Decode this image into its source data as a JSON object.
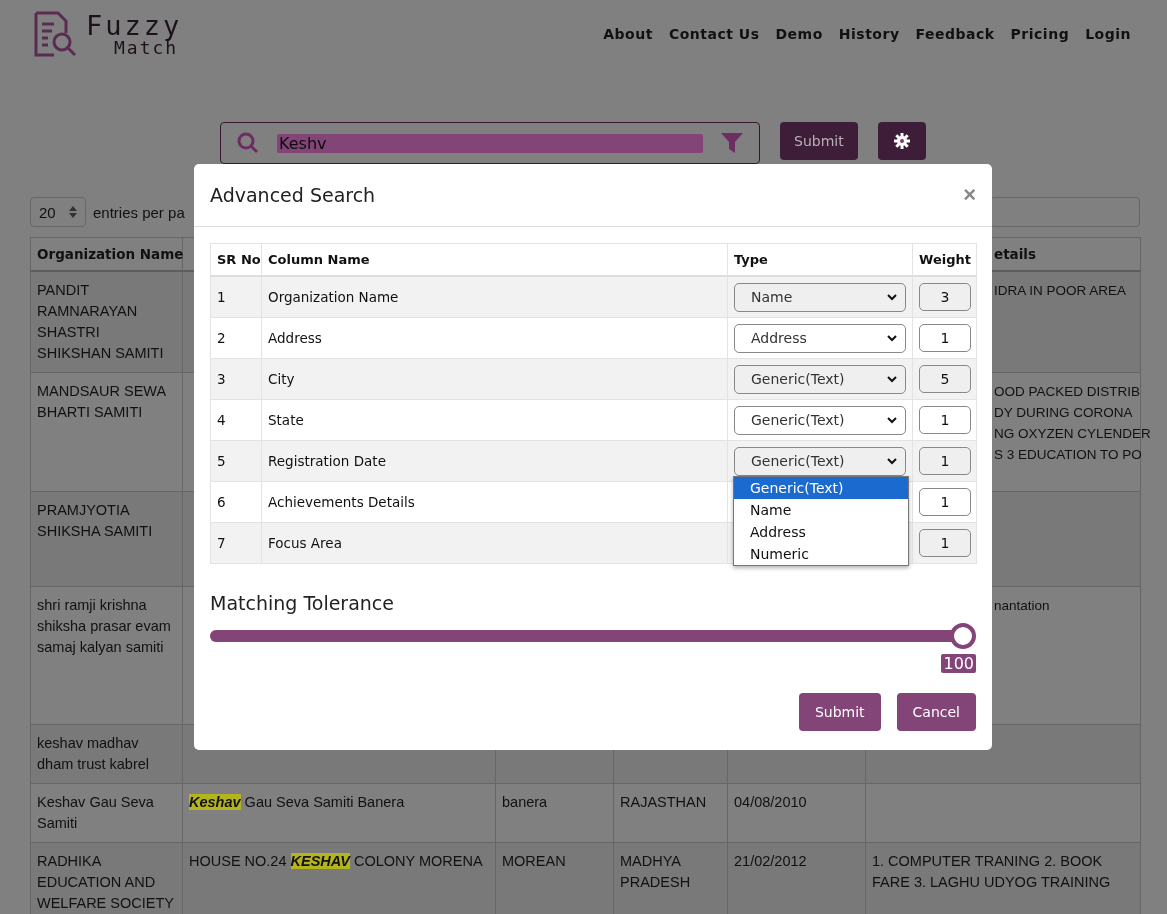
{
  "brand": {
    "line1": "Fuzzy",
    "line2": "Match"
  },
  "nav": [
    "About",
    "Contact Us",
    "Demo",
    "History",
    "Feedback",
    "Pricing",
    "Login"
  ],
  "search": {
    "value": "Keshv",
    "submit": "Submit"
  },
  "entries": {
    "value": "20",
    "label": "entries per pa"
  },
  "table": {
    "header": {
      "organization": "Organization Name",
      "details": [
        "etails"
      ]
    },
    "rows": [
      {
        "organization": "PANDIT RAMNARAYAN SHASTRI SHIKSHAN SAMITI",
        "details": [
          "IDRA IN POOR AREA"
        ]
      },
      {
        "organization": "MANDSAUR SEWA BHARTI SAMITI",
        "details": [
          "OOD PACKED DISTRIB",
          "DY DURING CORONA",
          "NG OXYZEN CYLENDER",
          "S 3 EDUCATION TO PO"
        ]
      },
      {
        "organization": "PRAMJYOTIA SHIKSHA SAMITI"
      },
      {
        "organization": "shri ramji krishna shiksha prasar evam samaj kalyan samiti",
        "details": [
          "nantation"
        ]
      },
      {
        "organization": "keshav madhav dham trust kabrel"
      },
      {
        "organization": "Keshav Gau Seva Samiti",
        "address": "**Keshav** Gau Seva Samiti Banera",
        "city": "banera",
        "state": "RAJASTHAN",
        "date": "04/08/2010"
      },
      {
        "organization": "RADHIKA EDUCATION AND WELFARE SOCIETY",
        "address": "HOUSE NO.24 **KESHAV** COLONY MORENA",
        "city": "MOREAN",
        "state": "MADHYA PRADESH",
        "date": "21/02/2012",
        "details": [
          "1. COMPUTER TRANING 2. BOOK FARE 3. LAGHU UDYOG TRAINING"
        ]
      }
    ]
  },
  "modal": {
    "title": "Advanced Search",
    "close": "×",
    "columns": [
      "SR No",
      "Column Name",
      "Type",
      "Weight"
    ],
    "rows": [
      {
        "sr": "1",
        "column": "Organization Name",
        "type": "Name",
        "weight": "3"
      },
      {
        "sr": "2",
        "column": "Address",
        "type": "Address",
        "weight": "1"
      },
      {
        "sr": "3",
        "column": "City",
        "type": "Generic(Text)",
        "weight": "5"
      },
      {
        "sr": "4",
        "column": "State",
        "type": "Generic(Text)",
        "weight": "1"
      },
      {
        "sr": "5",
        "column": "Registration Date",
        "type": "Generic(Text)",
        "weight": "1",
        "expanded": true
      },
      {
        "sr": "6",
        "column": "Achievements Details",
        "weight": "1"
      },
      {
        "sr": "7",
        "column": "Focus Area",
        "weight": "1"
      }
    ],
    "dropdown": [
      {
        "label": "Generic(Text)",
        "selected": true
      },
      {
        "label": "Name",
        "selected": false
      },
      {
        "label": "Address",
        "selected": false
      },
      {
        "label": "Numeric",
        "selected": false
      }
    ],
    "tolerance": {
      "label": "Matching Tolerance",
      "level": 1,
      "value": "100"
    },
    "buttons": [
      "Submit",
      "Cancel"
    ]
  }
}
